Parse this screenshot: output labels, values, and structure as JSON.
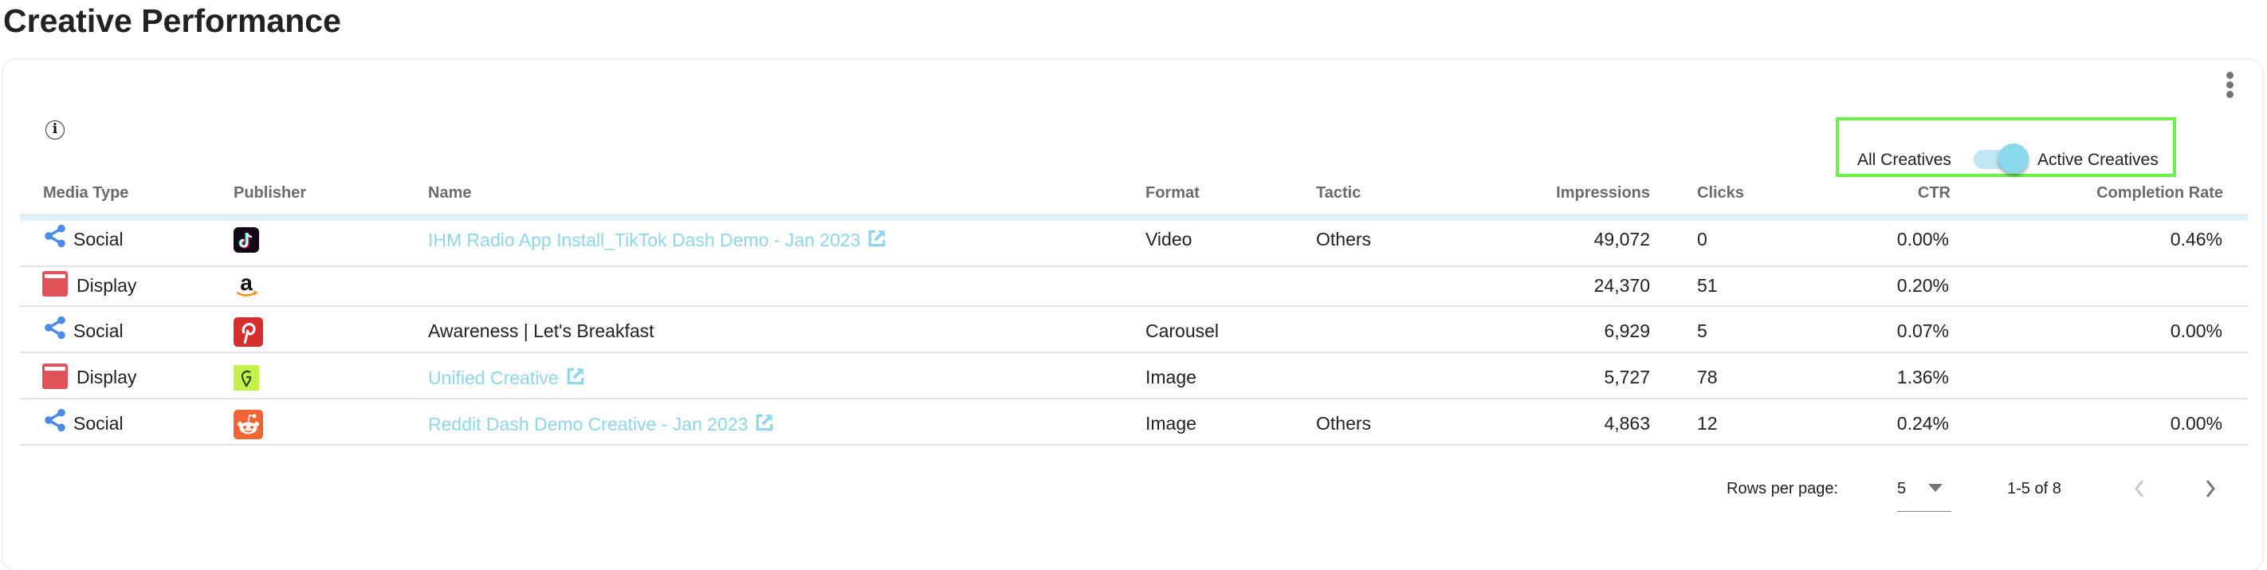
{
  "page": {
    "title": "Creative Performance"
  },
  "card": {
    "info_icon": "info-icon",
    "menu_icon": "more-vert-icon",
    "toggle": {
      "left_label": "All Creatives",
      "right_label": "Active Creatives",
      "state": "Active Creatives",
      "accent_color": "#8ad8ec"
    }
  },
  "table": {
    "columns": [
      "Media Type",
      "Publisher",
      "Name",
      "Format",
      "Tactic",
      "Impressions",
      "Clicks",
      "CTR",
      "Completion Rate"
    ],
    "rows": [
      {
        "media_type": "Social",
        "media_icon": "share-icon",
        "publisher": "TikTok",
        "publisher_icon": "tiktok-logo",
        "name": "IHM Radio App Install_TikTok Dash Demo - Jan 2023",
        "name_is_link": true,
        "format": "Video",
        "tactic": "Others",
        "impressions": "49,072",
        "clicks": "0",
        "ctr": "0.00%",
        "completion_rate": "0.46%"
      },
      {
        "media_type": "Display",
        "media_icon": "display-icon",
        "publisher": "Amazon",
        "publisher_icon": "amazon-logo",
        "name": "",
        "name_is_link": false,
        "format": "",
        "tactic": "",
        "impressions": "24,370",
        "clicks": "51",
        "ctr": "0.20%",
        "completion_rate": ""
      },
      {
        "media_type": "Social",
        "media_icon": "share-icon",
        "publisher": "Pinterest",
        "publisher_icon": "pinterest-logo",
        "name": "Awareness | Let's Breakfast",
        "name_is_link": false,
        "format": "Carousel",
        "tactic": "",
        "impressions": "6,929",
        "clicks": "5",
        "ctr": "0.07%",
        "completion_rate": "0.00%"
      },
      {
        "media_type": "Display",
        "media_icon": "display-icon",
        "publisher": "Unified",
        "publisher_icon": "unified-g-logo",
        "name": "Unified Creative",
        "name_is_link": true,
        "format": "Image",
        "tactic": "",
        "impressions": "5,727",
        "clicks": "78",
        "ctr": "1.36%",
        "completion_rate": ""
      },
      {
        "media_type": "Social",
        "media_icon": "share-icon",
        "publisher": "Reddit",
        "publisher_icon": "reddit-logo",
        "name": "Reddit Dash Demo Creative - Jan 2023",
        "name_is_link": true,
        "format": "Image",
        "tactic": "Others",
        "impressions": "4,863",
        "clicks": "12",
        "ctr": "0.24%",
        "completion_rate": "0.00%"
      }
    ]
  },
  "pagination": {
    "rows_per_page_label": "Rows per page:",
    "rows_per_page_value": "5",
    "range_label": "1-5 of 8",
    "prev_enabled": false,
    "next_enabled": true
  },
  "colors": {
    "link": "#8fd6ea",
    "social_icon": "#4a8be8",
    "display_icon": "#e0525a",
    "highlight_box": "#6cf04a"
  }
}
